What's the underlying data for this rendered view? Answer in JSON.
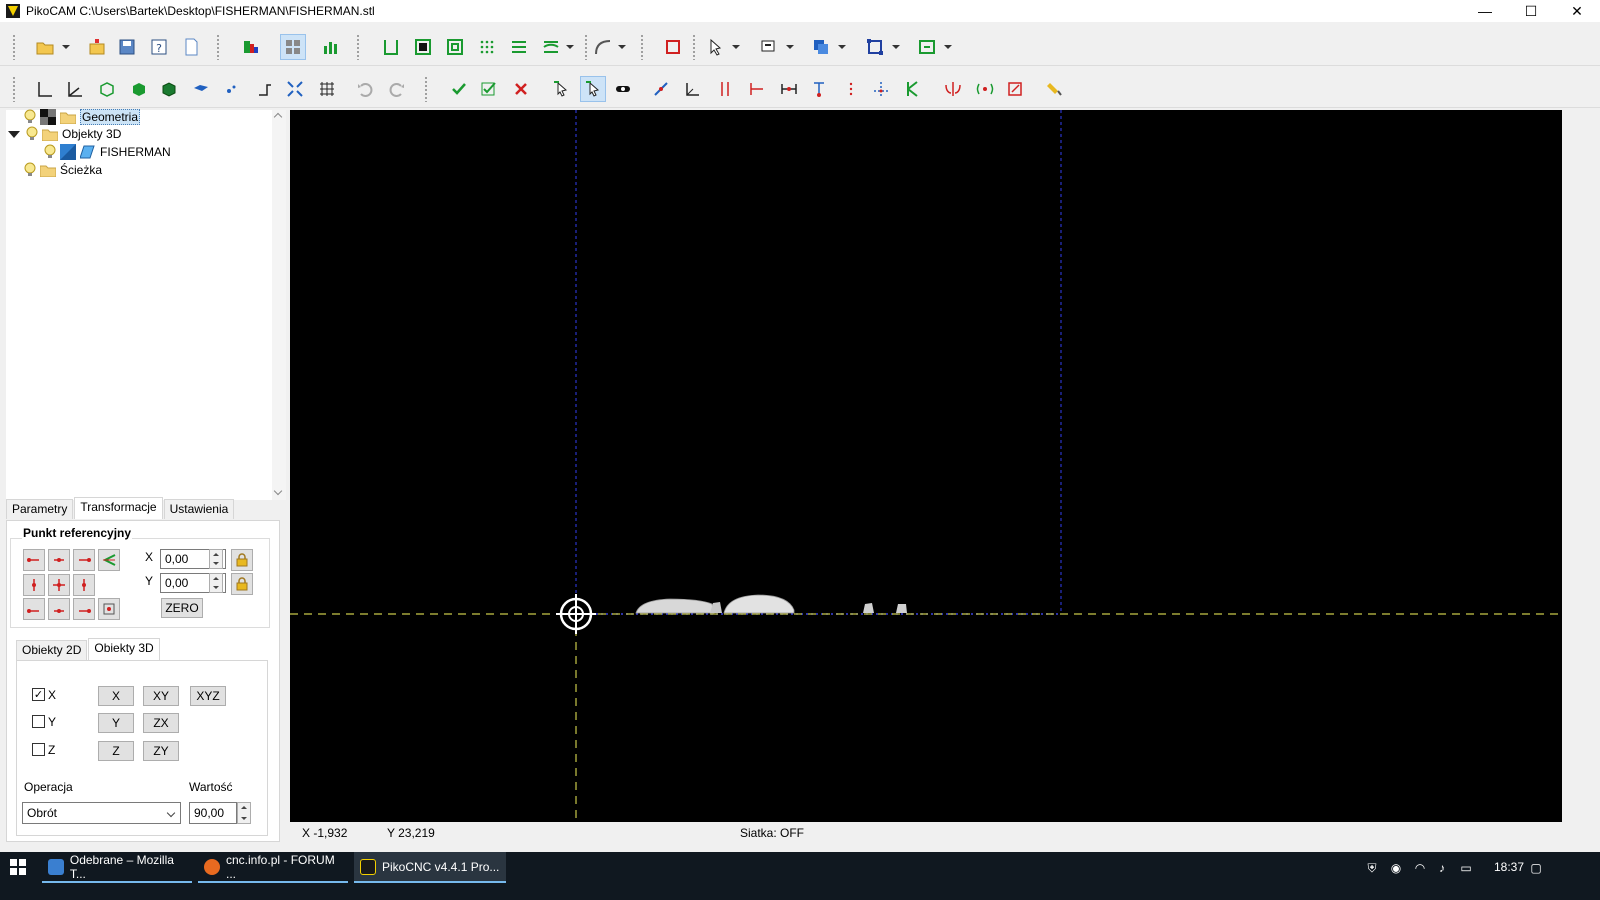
{
  "window": {
    "title": "PikoCAM  C:\\Users\\Bartek\\Desktop\\FISHERMAN\\FISHERMAN.stl",
    "minimize": "—",
    "maximize": "☐",
    "close": "✕"
  },
  "tree": {
    "items": [
      {
        "label": "Geometria",
        "selected": true
      },
      {
        "label": "Objekty 3D",
        "expanded": true
      },
      {
        "label": "FISHERMAN"
      },
      {
        "label": "Ścieżka"
      }
    ]
  },
  "main_tabs": [
    "Parametry",
    "Transformacje",
    "Ustawienia"
  ],
  "main_tab_active": "Transformacje",
  "ref_point": {
    "title": "Punkt referencyjny",
    "x_label": "X",
    "x_value": "0,00",
    "y_label": "Y",
    "y_value": "0,00",
    "zero_button": "ZERO"
  },
  "sub_tabs": [
    "Obiekty 2D",
    "Obiekty 3D"
  ],
  "sub_tab_active": "Obiekty 3D",
  "axes": {
    "checkboxes": [
      {
        "label": "X",
        "checked": true
      },
      {
        "label": "Y",
        "checked": false
      },
      {
        "label": "Z",
        "checked": false
      }
    ],
    "buttons_row1": [
      "X",
      "XY",
      "XYZ"
    ],
    "buttons_row2": [
      "Y",
      "ZX"
    ],
    "buttons_row3": [
      "Z",
      "ZY"
    ]
  },
  "operation": {
    "label": "Operacja",
    "value": "Obrót",
    "value_label": "Wartość",
    "amount": "90,00"
  },
  "status": {
    "x": "X -1,932",
    "y": "Y 23,219",
    "grid": "Siatka: OFF"
  },
  "taskbar": {
    "tasks": [
      {
        "label": "Odebrane – Mozilla T..."
      },
      {
        "label": "cnc.info.pl - FORUM ..."
      },
      {
        "label": "PikoCNC v4.4.1    Pro..."
      }
    ],
    "clock": "18:37"
  },
  "colors": {
    "viewport_bg": "#000000",
    "axis_dashed": "#c8c84a",
    "blue_guides": "#2a34c8",
    "accent": "#0078d7"
  }
}
